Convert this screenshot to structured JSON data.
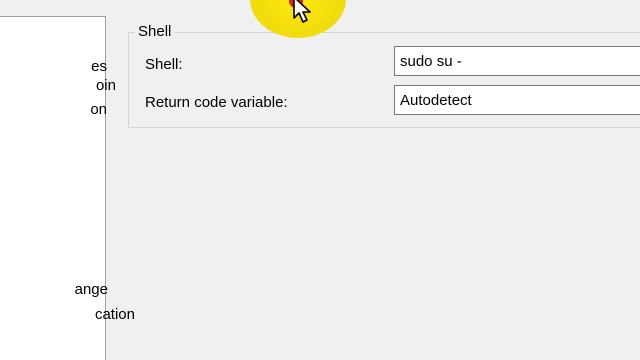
{
  "tree": {
    "items": [
      {
        "label": "es"
      },
      {
        "label": "oin"
      },
      {
        "label": "on"
      },
      {
        "label": "ange"
      },
      {
        "label": "cation"
      }
    ]
  },
  "shell_group": {
    "title": "Shell",
    "shell_label": "Shell:",
    "shell_value": "sudo su -",
    "return_code_label": "Return code variable:",
    "return_code_value": "Autodetect"
  },
  "colors": {
    "cursor_highlight": "#ffe800",
    "cursor_click": "#e02020"
  },
  "icons": {
    "cursor": "mouse-pointer-icon"
  }
}
